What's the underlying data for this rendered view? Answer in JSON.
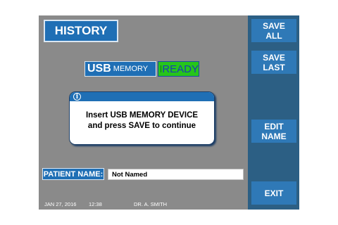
{
  "header": {
    "title": "HISTORY"
  },
  "usb_status": {
    "usb": "USB",
    "memory": "MEMORY",
    "state": "READY"
  },
  "dialog": {
    "icon": "info-icon",
    "line1": "Insert USB MEMORY DEVICE",
    "line2": "and press SAVE to continue"
  },
  "patient": {
    "label": "PATIENT NAME:",
    "value": "Not Named"
  },
  "footer": {
    "date": "JAN 27, 2016",
    "time": "12:38",
    "doctor": "DR. A. SMITH"
  },
  "side_buttons": {
    "save_all": {
      "line1": "SAVE",
      "line2": "ALL"
    },
    "save_last": {
      "line1": "SAVE",
      "line2": "LAST"
    },
    "edit_name": {
      "line1": "EDIT",
      "line2": "NAME"
    },
    "exit": {
      "label": "EXIT"
    }
  },
  "colors": {
    "screen": "#8a8a8a",
    "accent": "#1f6fb5",
    "panel": "#2c5f84",
    "ready": "#26c51a"
  }
}
